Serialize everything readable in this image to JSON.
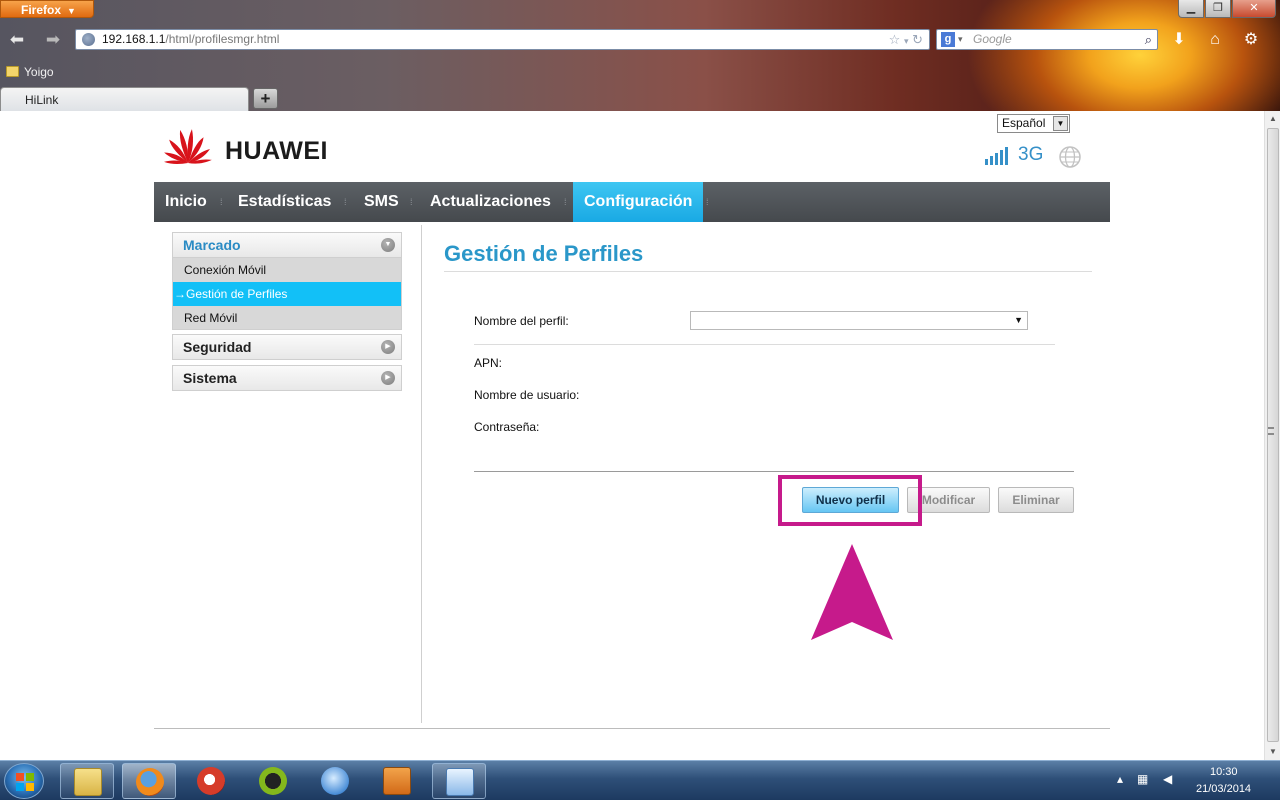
{
  "browser": {
    "menu_label": "Firefox",
    "url_host": "192.168.1.1",
    "url_path": "/html/profilesmgr.html",
    "search_placeholder": "Google",
    "search_engine_icon": "g",
    "bookmark_yoigo": "Yoigo",
    "tab_title": "HiLink",
    "new_tab_label": "+"
  },
  "header": {
    "brand": "HUAWEI",
    "language": "Español",
    "network_type": "3G"
  },
  "nav": {
    "items": [
      "Inicio",
      "Estadísticas",
      "SMS",
      "Actualizaciones",
      "Configuración"
    ],
    "active_index": 4,
    "separator": "⁞"
  },
  "sidebar": {
    "group_marcado": "Marcado",
    "sub_conexion": "Conexión Móvil",
    "sub_gestion": "→Gestión de Perfiles",
    "sub_red": "Red Móvil",
    "group_seguridad": "Seguridad",
    "group_sistema": "Sistema"
  },
  "main": {
    "title": "Gestión de Perfiles",
    "label_nombre_perfil": "Nombre del perfil:",
    "profile_value": "",
    "label_apn": "APN:",
    "label_usuario": "Nombre de usuario:",
    "label_contrasena": "Contraseña:",
    "btn_nuevo": "Nuevo perfil",
    "btn_modificar": "Modificar",
    "btn_eliminar": "Eliminar"
  },
  "annotation": {
    "highlight_color": "#c61a8b"
  },
  "taskbar": {
    "time": "10:30",
    "date": "21/03/2014"
  },
  "colors": {
    "accent_blue": "#19a9e4",
    "title_blue": "#2a97c9",
    "nav_bg": "#4f5357"
  }
}
